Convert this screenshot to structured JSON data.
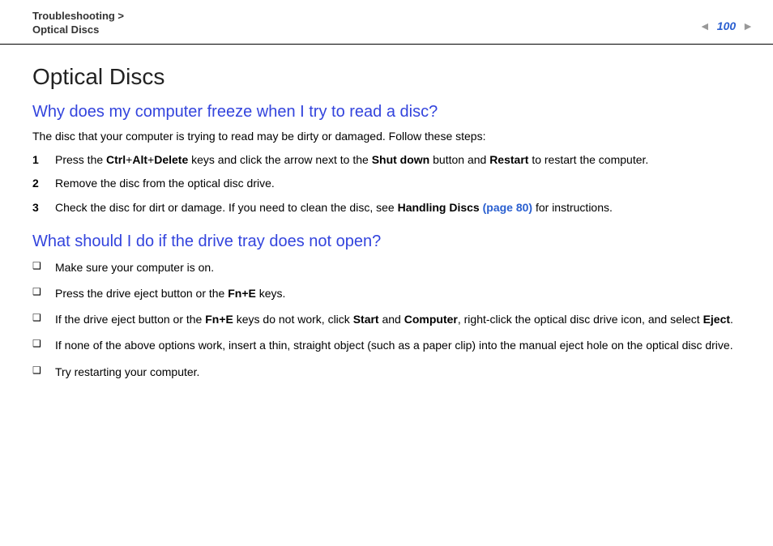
{
  "breadcrumb": {
    "line1": "Troubleshooting >",
    "line2": "Optical Discs"
  },
  "pageNumber": "100",
  "pageTitle": "Optical Discs",
  "section1": {
    "heading": "Why does my computer freeze when I try to read a disc?",
    "intro": "The disc that your computer is trying to read may be dirty or damaged. Follow these steps:",
    "steps": [
      {
        "num": "1",
        "pre": "Press the ",
        "b1": "Ctrl",
        "plus1": "+",
        "b2": "Alt",
        "plus2": "+",
        "b3": "Delete",
        "mid1": " keys and click the arrow next to the ",
        "b4": "Shut down",
        "mid2": " button and ",
        "b5": "Restart",
        "post": " to restart the computer."
      },
      {
        "num": "2",
        "text": "Remove the disc from the optical disc drive."
      },
      {
        "num": "3",
        "pre": "Check the disc for dirt or damage. If you need to clean the disc, see ",
        "b1": "Handling Discs ",
        "link": "(page 80)",
        "post": " for instructions."
      }
    ]
  },
  "section2": {
    "heading": "What should I do if the drive tray does not open?",
    "items": [
      {
        "text": "Make sure your computer is on."
      },
      {
        "pre": "Press the drive eject button or the ",
        "b1": "Fn+E",
        "post": " keys."
      },
      {
        "pre": "If the drive eject button or the ",
        "b1": "Fn+E",
        "mid1": " keys do not work, click ",
        "b2": "Start",
        "mid2": " and ",
        "b3": "Computer",
        "mid3": ", right-click the optical disc drive icon, and select ",
        "b4": "Eject",
        "post": "."
      },
      {
        "text": "If none of the above options work, insert a thin, straight object (such as a paper clip) into the manual eject hole on the optical disc drive."
      },
      {
        "text": "Try restarting your computer."
      }
    ]
  }
}
